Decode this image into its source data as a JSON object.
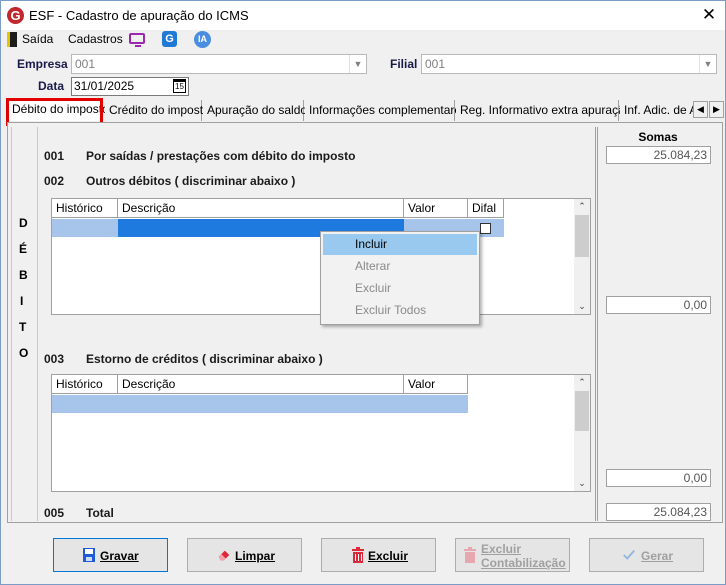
{
  "window": {
    "title": "ESF - Cadastro de apuração do ICMS",
    "close": "✕",
    "logo": "G"
  },
  "menu": {
    "saida": "Saída",
    "cadastros": "Cadastros",
    "icons": [
      "exit-icon",
      "monitor-icon",
      "g-app-icon",
      "ia-icon"
    ],
    "g_label": "G",
    "ia_label": "IA"
  },
  "form": {
    "empresa_label": "Empresa",
    "empresa_value": "001",
    "filial_label": "Filial",
    "filial_value": "001",
    "data_label": "Data",
    "data_value": "31/01/2025",
    "cal_label": "15"
  },
  "tabs": [
    "Débito do imposto",
    "Crédito do imposto",
    "Apuração do saldo",
    "Informações complementares",
    "Reg. Informativo extra apuração",
    "Inf. Adic. de A"
  ],
  "side_letters": [
    "D",
    "É",
    "B",
    "I",
    "T",
    "O"
  ],
  "sections": {
    "s001": {
      "code": "001",
      "text": "Por saídas / prestações com débito do imposto"
    },
    "s002": {
      "code": "002",
      "text": "Outros débitos ( discriminar abaixo )"
    },
    "s003": {
      "code": "003",
      "text": "Estorno de créditos ( discriminar abaixo )"
    },
    "s005": {
      "code": "005",
      "text": "Total"
    }
  },
  "grid1": {
    "headers": [
      "Histórico",
      "Descrição",
      "Valor",
      "Difal"
    ]
  },
  "grid2": {
    "headers": [
      "Histórico",
      "Descrição",
      "Valor"
    ]
  },
  "context_menu": [
    "Incluir",
    "Alterar",
    "Excluir",
    "Excluir Todos"
  ],
  "somas": {
    "header": "Somas",
    "s001": "25.084,23",
    "s002": "0,00",
    "s003": "0,00",
    "total": "25.084,23"
  },
  "buttons": {
    "gravar": "Gravar",
    "limpar": "Limpar",
    "excluir": "Excluir",
    "excluir_contab_1": "Excluir",
    "excluir_contab_2": "Contabilização",
    "gerar": "Gerar"
  },
  "colors": {
    "selection": "#1f7ae0",
    "highlight_box": "#e00000",
    "brand": "#c1272d"
  }
}
